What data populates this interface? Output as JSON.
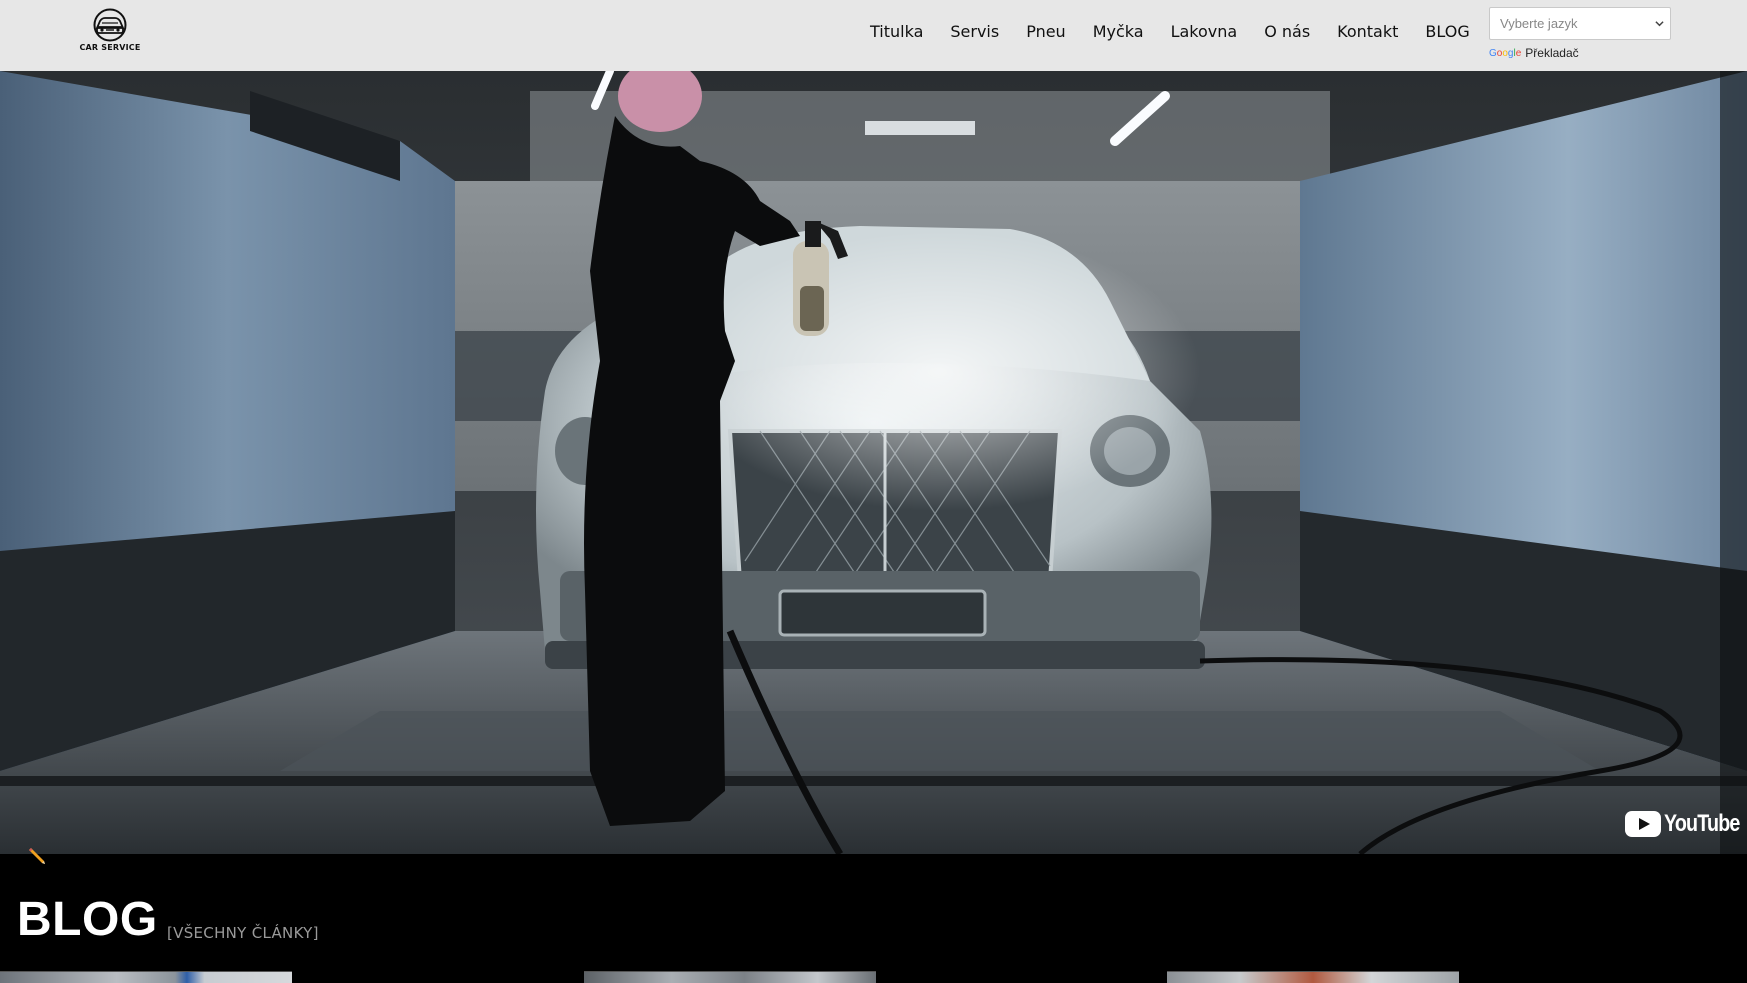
{
  "header": {
    "logo_text": "CAR SERVICE",
    "nav": [
      "Titulka",
      "Servis",
      "Pneu",
      "Myčka",
      "Lakovna",
      "O nás",
      "Kontakt",
      "BLOG"
    ],
    "language_select": {
      "value": "Vyberte jazyk"
    },
    "translate": {
      "google": "Google",
      "label": "Překladač"
    }
  },
  "hero": {
    "video_provider": "YouTube",
    "edit_icon": "pencil-icon"
  },
  "blog": {
    "title": "BLOG",
    "all_link": "[VŠECHNY ČLÁNKY]"
  },
  "colors": {
    "header_bg": "#f5f5f5",
    "page_bg": "#000000",
    "text_dark": "#111111",
    "muted": "#9a9a9a",
    "pencil": "#f0a020"
  }
}
